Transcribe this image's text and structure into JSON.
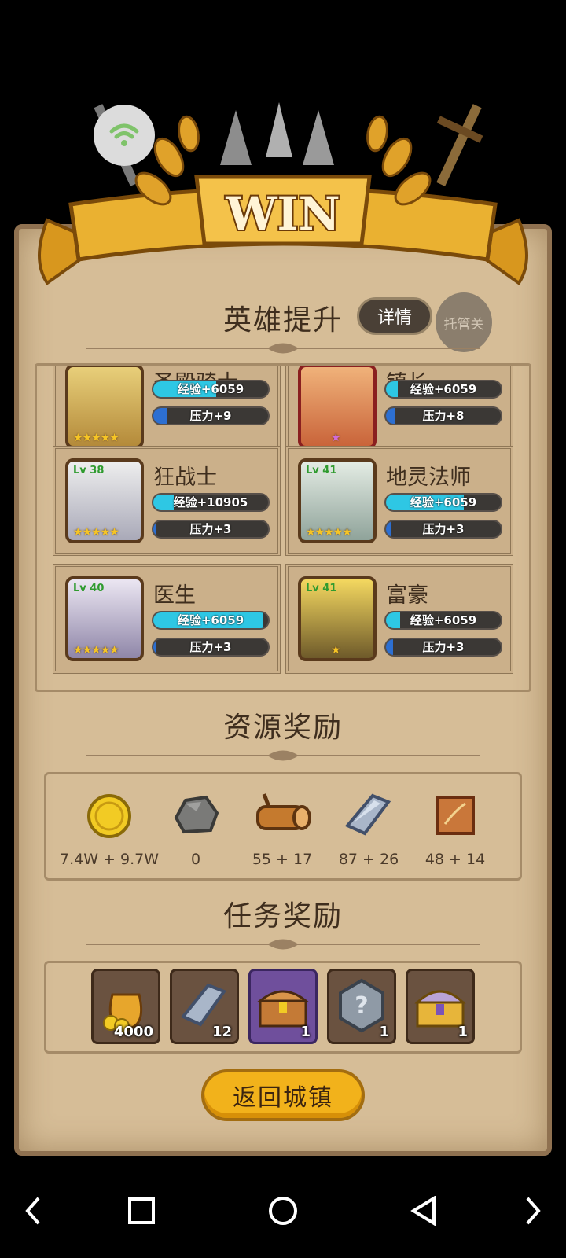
{
  "banner": {
    "title": "WIN"
  },
  "hero_section": {
    "title": "英雄提升",
    "detail_label": "详情",
    "auto_label": "托管关"
  },
  "heroes": [
    {
      "name": "圣殿骑士",
      "level": "",
      "exp": "经验+6059",
      "pressure": "压力+9",
      "stars": "★★★★★",
      "exp_fill": 0.55,
      "pressure_fill": 0.12
    },
    {
      "name": "镇长",
      "level": "",
      "exp": "经验+6059",
      "pressure": "压力+8",
      "stars": "★",
      "exp_fill": 0.1,
      "pressure_fill": 0.08
    },
    {
      "name": "狂战士",
      "level": "Lv 38",
      "exp": "经验+10905",
      "pressure": "压力+3",
      "stars": "★★★★★",
      "exp_fill": 0.18,
      "pressure_fill": 0.02
    },
    {
      "name": "地灵法师",
      "level": "Lv 41",
      "exp": "经验+6059",
      "pressure": "压力+3",
      "stars": "★★★★★",
      "exp_fill": 0.68,
      "pressure_fill": 0.04
    },
    {
      "name": "医生",
      "level": "Lv 40",
      "exp": "经验+6059",
      "pressure": "压力+3",
      "stars": "★★★★★",
      "exp_fill": 0.96,
      "pressure_fill": 0.02
    },
    {
      "name": "富豪",
      "level": "Lv 41",
      "exp": "经验+6059",
      "pressure": "压力+3",
      "stars": "★",
      "exp_fill": 0.12,
      "pressure_fill": 0.06
    }
  ],
  "resources_section": {
    "title": "资源奖励"
  },
  "resources": [
    {
      "icon": "gold-coin-icon",
      "value": "7.4W + 9.7W"
    },
    {
      "icon": "stone-icon",
      "value": "0"
    },
    {
      "icon": "wood-log-icon",
      "value": "55 + 17"
    },
    {
      "icon": "iron-ingot-icon",
      "value": "87 + 26"
    },
    {
      "icon": "leather-icon",
      "value": "48 + 14"
    }
  ],
  "tasks_section": {
    "title": "任务奖励"
  },
  "tasks": [
    {
      "icon": "gold-bag-icon",
      "count": "4000"
    },
    {
      "icon": "iron-ingot-icon",
      "count": "12"
    },
    {
      "icon": "treasure-chest-icon",
      "count": "1"
    },
    {
      "icon": "mystery-gem-icon",
      "count": "1"
    },
    {
      "icon": "golden-chest-icon",
      "count": "1"
    }
  ],
  "return_button": "返回城镇",
  "colors": {
    "exp_bar": "#2ec7e4",
    "pressure_bar": "#2d6fd1",
    "gold": "#f2b21b",
    "parchment": "#d6bd97"
  }
}
